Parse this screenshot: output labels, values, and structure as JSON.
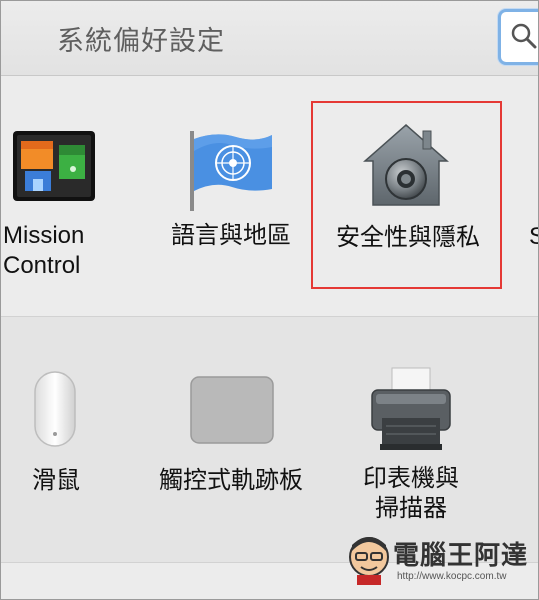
{
  "window": {
    "title": "系統偏好設定"
  },
  "row1": {
    "panes": [
      {
        "id": "mission-control",
        "label": "Mission\nControl",
        "icon": "mission-control-icon"
      },
      {
        "id": "language-region",
        "label": "語言與地區",
        "icon": "united-nations-flag-icon"
      },
      {
        "id": "security-privacy",
        "label": "安全性與隱私",
        "icon": "security-house-icon"
      }
    ],
    "partial_label": "S"
  },
  "row2": {
    "panes": [
      {
        "id": "mouse",
        "label": "滑鼠",
        "icon": "mouse-icon"
      },
      {
        "id": "trackpad",
        "label": "觸控式軌跡板",
        "icon": "trackpad-icon"
      },
      {
        "id": "printers-scanners",
        "label": "印表機與\n掃描器",
        "icon": "printer-icon"
      }
    ]
  },
  "watermark": {
    "text": "電腦王阿達",
    "url": "http://www.kocpc.com.tw"
  },
  "colors": {
    "highlight": "#e53935",
    "search_focus": "#7fb2e6",
    "background": "#ececec"
  }
}
